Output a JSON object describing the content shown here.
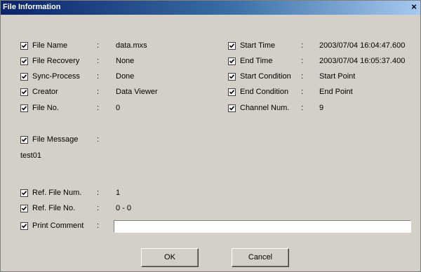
{
  "window": {
    "title": "File Information",
    "close_glyph": "×"
  },
  "colon": ":",
  "left_fields": [
    {
      "label": "File Name",
      "value": "data.mxs",
      "checked": true
    },
    {
      "label": "File Recovery",
      "value": "None",
      "checked": true
    },
    {
      "label": "Sync-Process",
      "value": "Done",
      "checked": true
    },
    {
      "label": "Creator",
      "value": "Data Viewer",
      "checked": true
    },
    {
      "label": "File No.",
      "value": "0",
      "checked": true
    }
  ],
  "right_fields": [
    {
      "label": "Start Time",
      "value": "2003/07/04 16:04:47.600",
      "checked": true
    },
    {
      "label": "End Time",
      "value": "2003/07/04 16:05:37.400",
      "checked": true
    },
    {
      "label": "Start Condition",
      "value": "Start Point",
      "checked": true
    },
    {
      "label": "End Condition",
      "value": "End Point",
      "checked": true
    },
    {
      "label": "Channel Num.",
      "value": "9",
      "checked": true
    }
  ],
  "file_message": {
    "label": "File Message",
    "value": "test01",
    "checked": true
  },
  "ref_file_num": {
    "label": "Ref. File Num.",
    "value": "1",
    "checked": true
  },
  "ref_file_no": {
    "label": "Ref. File No.",
    "value": "0 - 0",
    "checked": true
  },
  "print_comment": {
    "label": "Print Comment",
    "value": "",
    "checked": true
  },
  "buttons": {
    "ok": "OK",
    "cancel": "Cancel"
  },
  "colors": {
    "title_bar_start": "#0a246a",
    "title_bar_end": "#a6caf0",
    "dialog_bg": "#d4d0c8"
  },
  "icons": {
    "checkbox_checked": "checkmark-icon",
    "close": "close-icon"
  }
}
